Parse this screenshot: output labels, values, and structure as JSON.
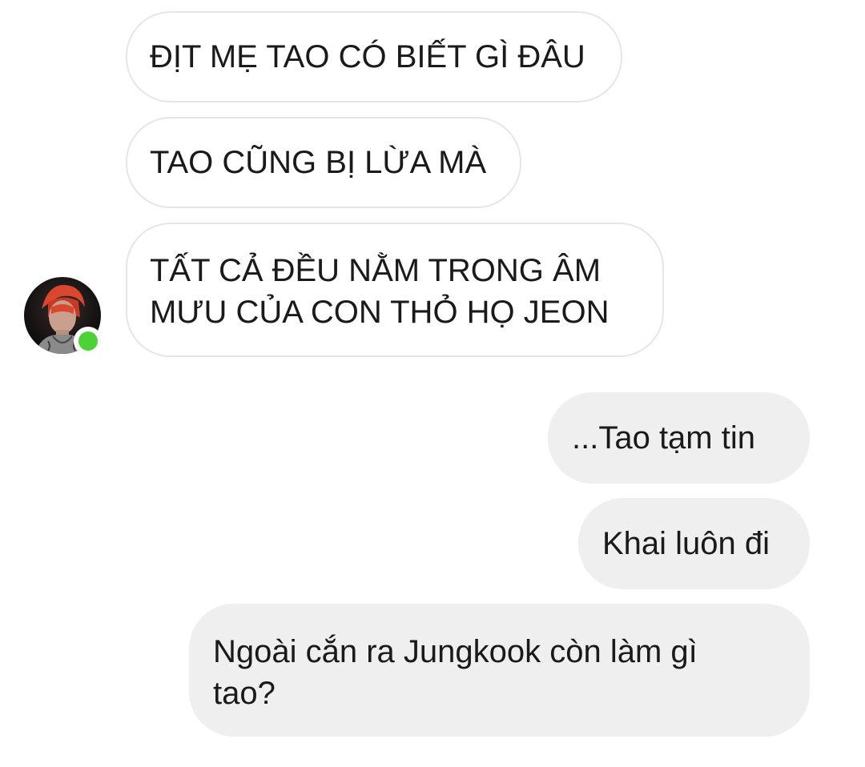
{
  "conversation": {
    "incoming": [
      {
        "text": "ĐỊT MẸ TAO CÓ BIẾT GÌ ĐÂU"
      },
      {
        "text": "TAO CŨNG BỊ LỪA MÀ"
      },
      {
        "line1": "TẤT CẢ ĐỀU NẰM TRONG ÂM",
        "line2": "MƯU CỦA CON THỎ HỌ JEON"
      }
    ],
    "outgoing": [
      {
        "text": "...Tao tạm tin"
      },
      {
        "text": "Khai luôn đi"
      },
      {
        "line1": "Ngoài cắn ra Jungkook còn làm gì",
        "line2": "tao?"
      }
    ]
  },
  "sender": {
    "avatar_icon": "profile-photo",
    "online": true,
    "presence_color": "#4cd137"
  },
  "colors": {
    "incoming_bubble_bg": "#ffffff",
    "incoming_bubble_border": "#e6e6e6",
    "outgoing_bubble_bg": "#efefef"
  }
}
